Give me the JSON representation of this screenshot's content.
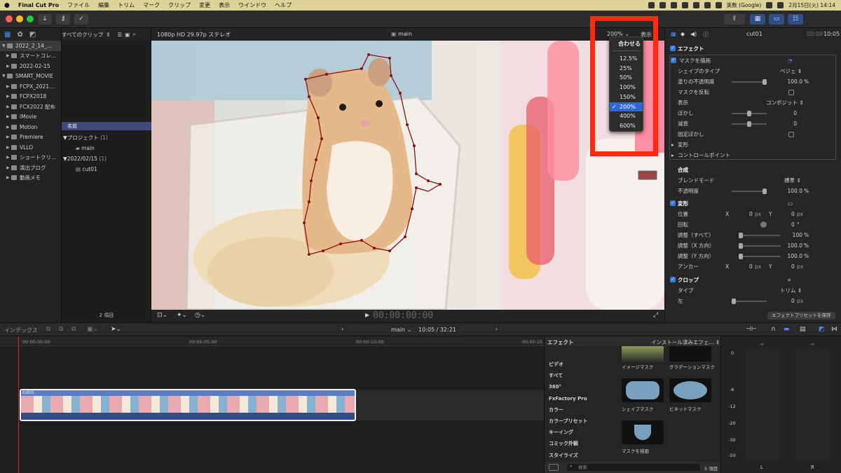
{
  "menubar": {
    "apple": "",
    "app": "Final Cut Pro",
    "items": [
      "ファイル",
      "編集",
      "トリム",
      "マーク",
      "クリップ",
      "変更",
      "表示",
      "ウインドウ",
      "ヘルプ"
    ],
    "input_method": "英数 (Google)",
    "datetime": "2月15日(火) 14:14"
  },
  "library": {
    "items": [
      {
        "label": "2022_2_14_...",
        "tri": "▼",
        "selected": true
      },
      {
        "label": "スマートコレ...",
        "tri": "▶"
      },
      {
        "label": "2022-02-15",
        "tri": "▶"
      },
      {
        "label": "SMART_MOVIE",
        "tri": "▼"
      },
      {
        "label": "FCPX_2021...",
        "tri": "▶"
      },
      {
        "label": "FCPX2018",
        "tri": "▶"
      },
      {
        "label": "FCX2022 配布",
        "tri": "▶"
      },
      {
        "label": "iMovie",
        "tri": "▶"
      },
      {
        "label": "Motion",
        "tri": "▶"
      },
      {
        "label": "Premiere",
        "tri": "▶"
      },
      {
        "label": "VLLO",
        "tri": "▶"
      },
      {
        "label": "ショートクリ...",
        "tri": "▶"
      },
      {
        "label": "演出ブログ",
        "tri": "▶"
      },
      {
        "label": "動画メモ",
        "tri": "▶"
      }
    ]
  },
  "browser": {
    "filter": "すべてのクリップ",
    "col_name": "名前",
    "project_group": "プロジェクト",
    "project_count": "(1)",
    "project_item": "main",
    "date_group": "2022/02/15",
    "date_count": "(1)",
    "date_item": "cut01",
    "footer": "2 項目"
  },
  "viewer": {
    "format": "1080p HD 29.97p ステレオ",
    "title": "main",
    "zoom": "200%",
    "view_label": "表示",
    "timecode": "00:00:00:00"
  },
  "zoom_menu": {
    "fit": "合わせる",
    "options": [
      "12.5%",
      "25%",
      "50%",
      "100%",
      "150%",
      "200%",
      "400%",
      "600%"
    ],
    "selected": "200%",
    "check": "✓"
  },
  "inspector": {
    "clip_name": "cut01",
    "duration": "00:00",
    "time": "10:05",
    "effects_label": "エフェクト",
    "mask_label": "マスクを描画",
    "shape_type_label": "シェイプのタイプ",
    "shape_type_val": "ベジェ",
    "fill_opacity_label": "塗りの不透明度",
    "fill_opacity_val": "100.0",
    "invert_label": "マスクを反転",
    "view_label": "表示",
    "view_val": "コンポジット",
    "feather_label": "ぼかし",
    "feather_val": "0",
    "falloff_label": "減衰",
    "falloff_val": "0",
    "fixed_feather_label": "固定ぼかし",
    "transform_sub": "変形",
    "control_points": "コントロールポイント",
    "composite_label": "合成",
    "blend_label": "ブレンドモード",
    "blend_val": "標準",
    "opacity_label": "不透明度",
    "opacity_val": "100.0",
    "transform_label": "変形",
    "position_label": "位置",
    "pos_x_axis": "X",
    "pos_x": "0",
    "pos_y_axis": "Y",
    "pos_y": "0",
    "px": "px",
    "rotation_label": "回転",
    "rotation_val": "0",
    "degree": "°",
    "scale_all_label": "調整（すべて）",
    "scale_all_val": "100",
    "scale_x_label": "調整（X 方向）",
    "scale_x_val": "100.0",
    "scale_y_label": "調整（Y 方向）",
    "scale_y_val": "100.0",
    "anchor_label": "アンカー",
    "anchor_x_axis": "X",
    "anchor_x": "0",
    "anchor_y_axis": "Y",
    "anchor_y": "0",
    "crop_label": "クロップ",
    "crop_type_label": "タイプ",
    "crop_type_val": "トリム",
    "crop_left_label": "左",
    "crop_left_val": "0",
    "save_preset": "エフェクトプリセットを保存",
    "percent": "%"
  },
  "timeline": {
    "index_label": "インデックス",
    "project": "main",
    "position": "10:05 / 32:21",
    "ruler": [
      "00:00:00:00",
      "00:00:05:00",
      "00:00:10:00",
      "00:00:15"
    ],
    "clip_name": "cut01"
  },
  "effects": {
    "header": "エフェクト",
    "installed": "インストール済みエフェ...",
    "categories": [
      "ビデオ",
      "すべて",
      "360°",
      "FxFactory Pro",
      "カラー",
      "カラープリセット",
      "キーイング",
      "コミック外観",
      "スタイライズ"
    ],
    "thumbs": [
      "イメージマスク",
      "グラデーションマスク",
      "シェイプマスク",
      "ビネットマスク",
      "マスクを描画"
    ],
    "search_placeholder": "検索",
    "count": "5 項目"
  },
  "meters": {
    "top_l": "-∞",
    "top_r": "-∞",
    "scale": [
      "0",
      "-6",
      "-12",
      "-20",
      "-30",
      "-50"
    ],
    "left": "L",
    "right": "R"
  },
  "colors": {
    "accent": "#2f68d2",
    "highlight": "#ff2a14",
    "mask_path": "#8b0f0f"
  }
}
